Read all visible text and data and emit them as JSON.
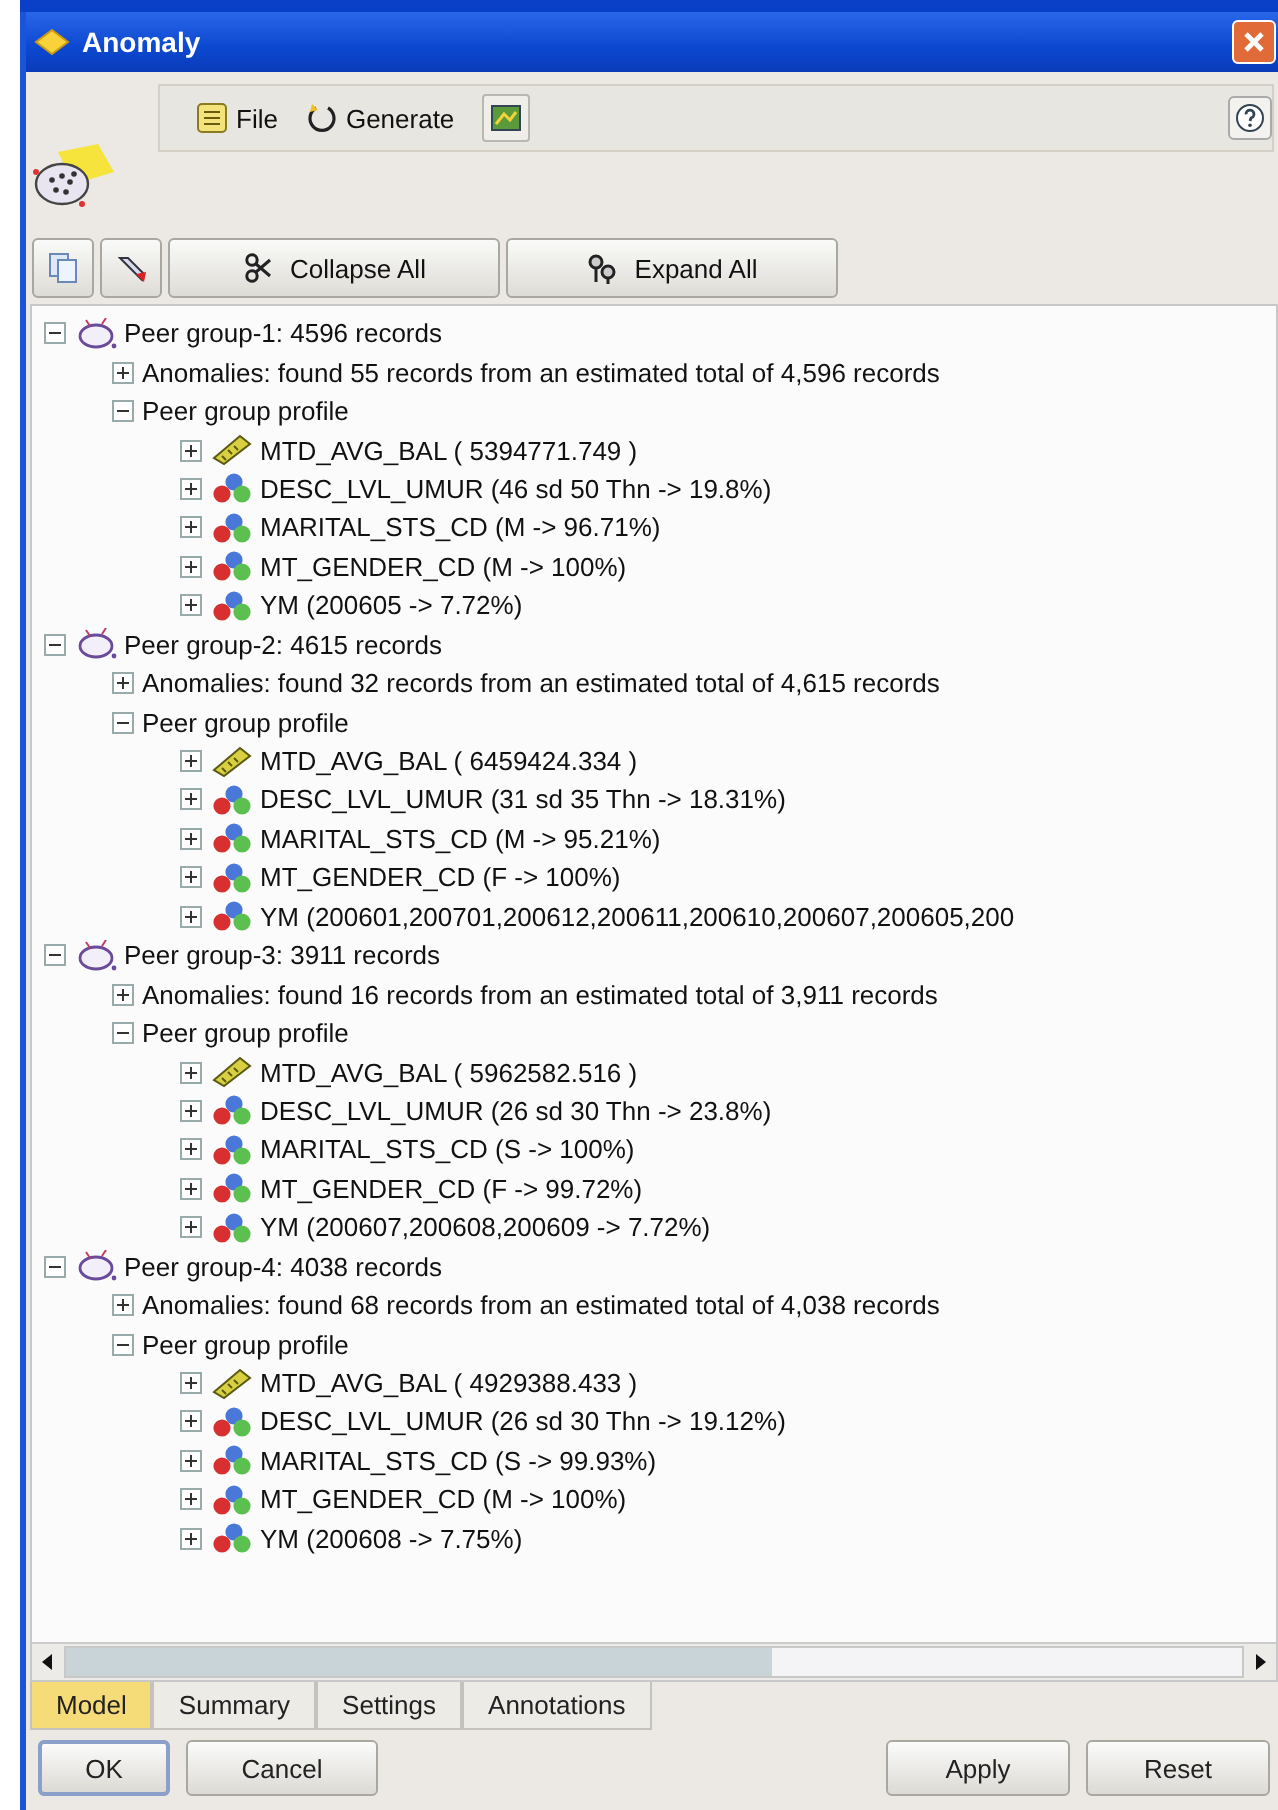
{
  "window": {
    "title": "Anomaly"
  },
  "menu": [
    {
      "label": "File",
      "kind": "file"
    },
    {
      "label": "Generate",
      "kind": "generate"
    }
  ],
  "toolbar_buttons": [
    {
      "label": "Collapse All",
      "kind": "collapse"
    },
    {
      "label": "Expand All",
      "kind": "expand"
    }
  ],
  "tree": [
    {
      "label": "Peer group-1: 4596 records",
      "kind": "group",
      "expanded": true,
      "children": [
        {
          "label": "Anomalies: found 55 records from an estimated total of 4,596 records",
          "expanded": false
        },
        {
          "label": "Peer group profile",
          "expanded": true,
          "children": [
            {
              "label": "MTD_AVG_BAL ( 5394771.749 )",
              "kind": "range",
              "expanded": false
            },
            {
              "label": "DESC_LVL_UMUR (46 sd 50 Thn -> 19.8%)",
              "kind": "set",
              "expanded": false
            },
            {
              "label": "MARITAL_STS_CD (M -> 96.71%)",
              "kind": "set",
              "expanded": false
            },
            {
              "label": "MT_GENDER_CD (M -> 100%)",
              "kind": "set",
              "expanded": false
            },
            {
              "label": "YM (200605 -> 7.72%)",
              "kind": "set",
              "expanded": false
            }
          ]
        }
      ]
    },
    {
      "label": "Peer group-2: 4615 records",
      "kind": "group",
      "expanded": true,
      "children": [
        {
          "label": "Anomalies: found 32 records from an estimated total of 4,615 records",
          "expanded": false
        },
        {
          "label": "Peer group profile",
          "expanded": true,
          "children": [
            {
              "label": "MTD_AVG_BAL ( 6459424.334 )",
              "kind": "range",
              "expanded": false
            },
            {
              "label": "DESC_LVL_UMUR (31 sd 35 Thn -> 18.31%)",
              "kind": "set",
              "expanded": false
            },
            {
              "label": "MARITAL_STS_CD (M -> 95.21%)",
              "kind": "set",
              "expanded": false
            },
            {
              "label": "MT_GENDER_CD (F -> 100%)",
              "kind": "set",
              "expanded": false
            },
            {
              "label": "YM (200601,200701,200612,200611,200610,200607,200605,200",
              "kind": "set",
              "expanded": false
            }
          ]
        }
      ]
    },
    {
      "label": "Peer group-3: 3911 records",
      "kind": "group",
      "expanded": true,
      "children": [
        {
          "label": "Anomalies: found 16 records from an estimated total of 3,911 records",
          "expanded": false
        },
        {
          "label": "Peer group profile",
          "expanded": true,
          "children": [
            {
              "label": "MTD_AVG_BAL ( 5962582.516 )",
              "kind": "range",
              "expanded": false
            },
            {
              "label": "DESC_LVL_UMUR (26 sd 30 Thn -> 23.8%)",
              "kind": "set",
              "expanded": false
            },
            {
              "label": "MARITAL_STS_CD (S -> 100%)",
              "kind": "set",
              "expanded": false
            },
            {
              "label": "MT_GENDER_CD (F -> 99.72%)",
              "kind": "set",
              "expanded": false
            },
            {
              "label": "YM (200607,200608,200609 -> 7.72%)",
              "kind": "set",
              "expanded": false
            }
          ]
        }
      ]
    },
    {
      "label": "Peer group-4: 4038 records",
      "kind": "group",
      "expanded": true,
      "children": [
        {
          "label": "Anomalies: found 68 records from an estimated total of 4,038 records",
          "expanded": false
        },
        {
          "label": "Peer group profile",
          "expanded": true,
          "children": [
            {
              "label": "MTD_AVG_BAL ( 4929388.433 )",
              "kind": "range",
              "expanded": false
            },
            {
              "label": "DESC_LVL_UMUR (26 sd 30 Thn -> 19.12%)",
              "kind": "set",
              "expanded": false
            },
            {
              "label": "MARITAL_STS_CD (S -> 99.93%)",
              "kind": "set",
              "expanded": false
            },
            {
              "label": "MT_GENDER_CD (M -> 100%)",
              "kind": "set",
              "expanded": false
            },
            {
              "label": "YM (200608 -> 7.75%)",
              "kind": "set",
              "expanded": false
            }
          ]
        }
      ]
    }
  ],
  "tabs": [
    {
      "label": "Model",
      "selected": true
    },
    {
      "label": "Summary",
      "selected": false
    },
    {
      "label": "Settings",
      "selected": false
    },
    {
      "label": "Annotations",
      "selected": false
    }
  ],
  "buttons": [
    {
      "label": "OK",
      "kind": "default"
    },
    {
      "label": "Cancel",
      "kind": "left"
    },
    {
      "label": "Apply",
      "kind": "right"
    },
    {
      "label": "Reset",
      "kind": "right"
    }
  ]
}
